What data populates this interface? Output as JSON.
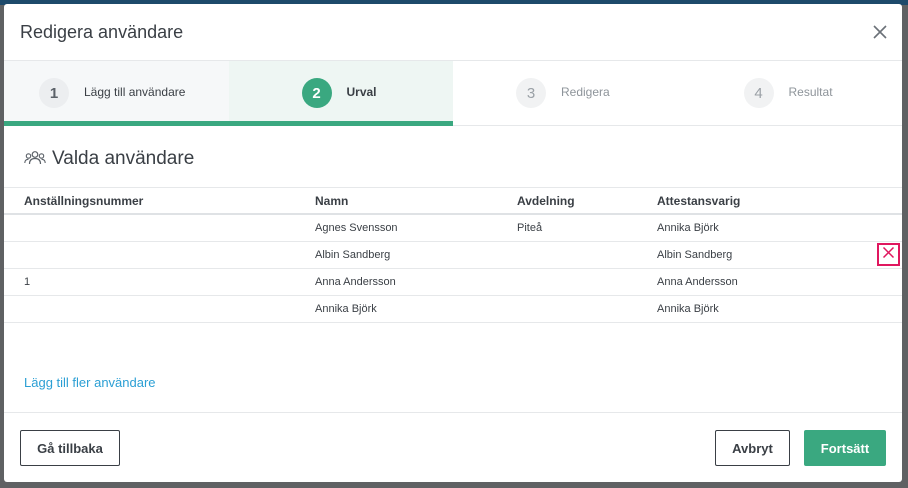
{
  "modal": {
    "title": "Redigera användare"
  },
  "steps": [
    {
      "number": "1",
      "label": "Lägg till användare",
      "state": "done"
    },
    {
      "number": "2",
      "label": "Urval",
      "state": "active"
    },
    {
      "number": "3",
      "label": "Redigera",
      "state": "upcoming"
    },
    {
      "number": "4",
      "label": "Resultat",
      "state": "upcoming"
    }
  ],
  "section": {
    "title": "Valda användare",
    "icon": "users-icon"
  },
  "table": {
    "headers": [
      "Anställningsnummer",
      "Namn",
      "Avdelning",
      "Attestansvarig"
    ],
    "rows": [
      [
        "",
        "Agnes Svensson",
        "Piteå",
        "Annika Björk"
      ],
      [
        "",
        "Albin Sandberg",
        "",
        "Albin Sandberg"
      ],
      [
        "1",
        "Anna Andersson",
        "",
        "Anna Andersson"
      ],
      [
        "",
        "Annika Björk",
        "",
        "Annika Björk"
      ]
    ]
  },
  "links": {
    "add_more": "Lägg till fler användare"
  },
  "footer": {
    "back_label": "Gå tillbaka",
    "cancel_label": "Avbryt",
    "continue_label": "Fortsätt"
  },
  "colors": {
    "accent": "#3aa880",
    "link": "#2b9fd4",
    "highlight": "#e0175f"
  }
}
